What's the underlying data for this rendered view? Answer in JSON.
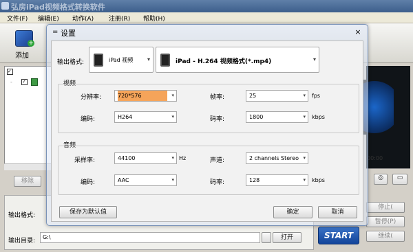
{
  "app": {
    "title": "弘房iPad视频格式转换软件"
  },
  "menu": [
    "文件(F)",
    "编辑(E)",
    "动作(A)",
    "注册(R)",
    "帮助(H)"
  ],
  "toolbar": {
    "add_label": "添加"
  },
  "main": {
    "remove_label": "移除",
    "list_row_text": "..."
  },
  "bottom": {
    "output_format_label": "输出格式:",
    "output_dir_label": "输出目录:",
    "output_dir_value": "G:\\",
    "open_label": "打开",
    "start_label": "START",
    "stop_label": "停止(",
    "pause_label": "暂停(P)",
    "continue_label": "继续(",
    "time_text": "00:00"
  },
  "dialog": {
    "title": "设置",
    "close": "×",
    "format_label": "输出格式:",
    "device": "iPad 视频",
    "profile": "iPad - H.264 视频格式(*.mp4)",
    "video": {
      "group_label": "视频",
      "resolution_label": "分辨率:",
      "resolution": "720*576",
      "framerate_label": "帧率:",
      "framerate": "25",
      "fps_unit": "fps",
      "codec_label": "编码:",
      "codec": "H264",
      "bitrate_label": "码率:",
      "bitrate": "1800",
      "kbps_unit": "kbps"
    },
    "audio": {
      "group_label": "音频",
      "samplerate_label": "采样率:",
      "samplerate": "44100",
      "hz_unit": "Hz",
      "channels_label": "声道:",
      "channels": "2 channels Stereo",
      "codec_label": "编码:",
      "codec": "AAC",
      "bitrate_label": "码率:",
      "bitrate": "128",
      "kbps_unit": "kbps"
    },
    "save_default": "保存为默认值",
    "ok": "确定",
    "cancel": "取消"
  },
  "colors": {
    "highlight": "#f5a45a",
    "start_bg": "#1b4fa4"
  }
}
